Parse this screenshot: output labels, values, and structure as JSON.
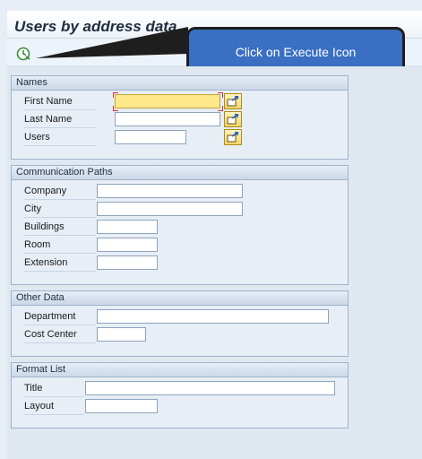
{
  "window": {
    "title": "Users by address data"
  },
  "toolbar": {
    "execute_icon": "execute-clock-icon"
  },
  "callout": {
    "text": "Click on Execute Icon"
  },
  "groups": {
    "names": {
      "title": "Names",
      "fields": [
        {
          "label": "First Name",
          "value": "",
          "has_multiselect": true,
          "focused": true
        },
        {
          "label": "Last Name",
          "value": "",
          "has_multiselect": true
        },
        {
          "label": "Users",
          "value": "",
          "has_multiselect": true
        }
      ]
    },
    "communication": {
      "title": "Communication Paths",
      "fields": [
        {
          "label": "Company",
          "value": ""
        },
        {
          "label": "City",
          "value": ""
        },
        {
          "label": "Buildings",
          "value": ""
        },
        {
          "label": "Room",
          "value": ""
        },
        {
          "label": "Extension",
          "value": ""
        }
      ]
    },
    "other": {
      "title": "Other Data",
      "fields": [
        {
          "label": "Department",
          "value": ""
        },
        {
          "label": "Cost Center",
          "value": ""
        }
      ]
    },
    "format": {
      "title": "Format List",
      "fields": [
        {
          "label": "Title",
          "value": ""
        },
        {
          "label": "Layout",
          "value": ""
        }
      ]
    }
  },
  "colors": {
    "focus_field": "#fde88a",
    "callout_bg": "#3a6fc2",
    "group_border": "#9fb3c8"
  }
}
